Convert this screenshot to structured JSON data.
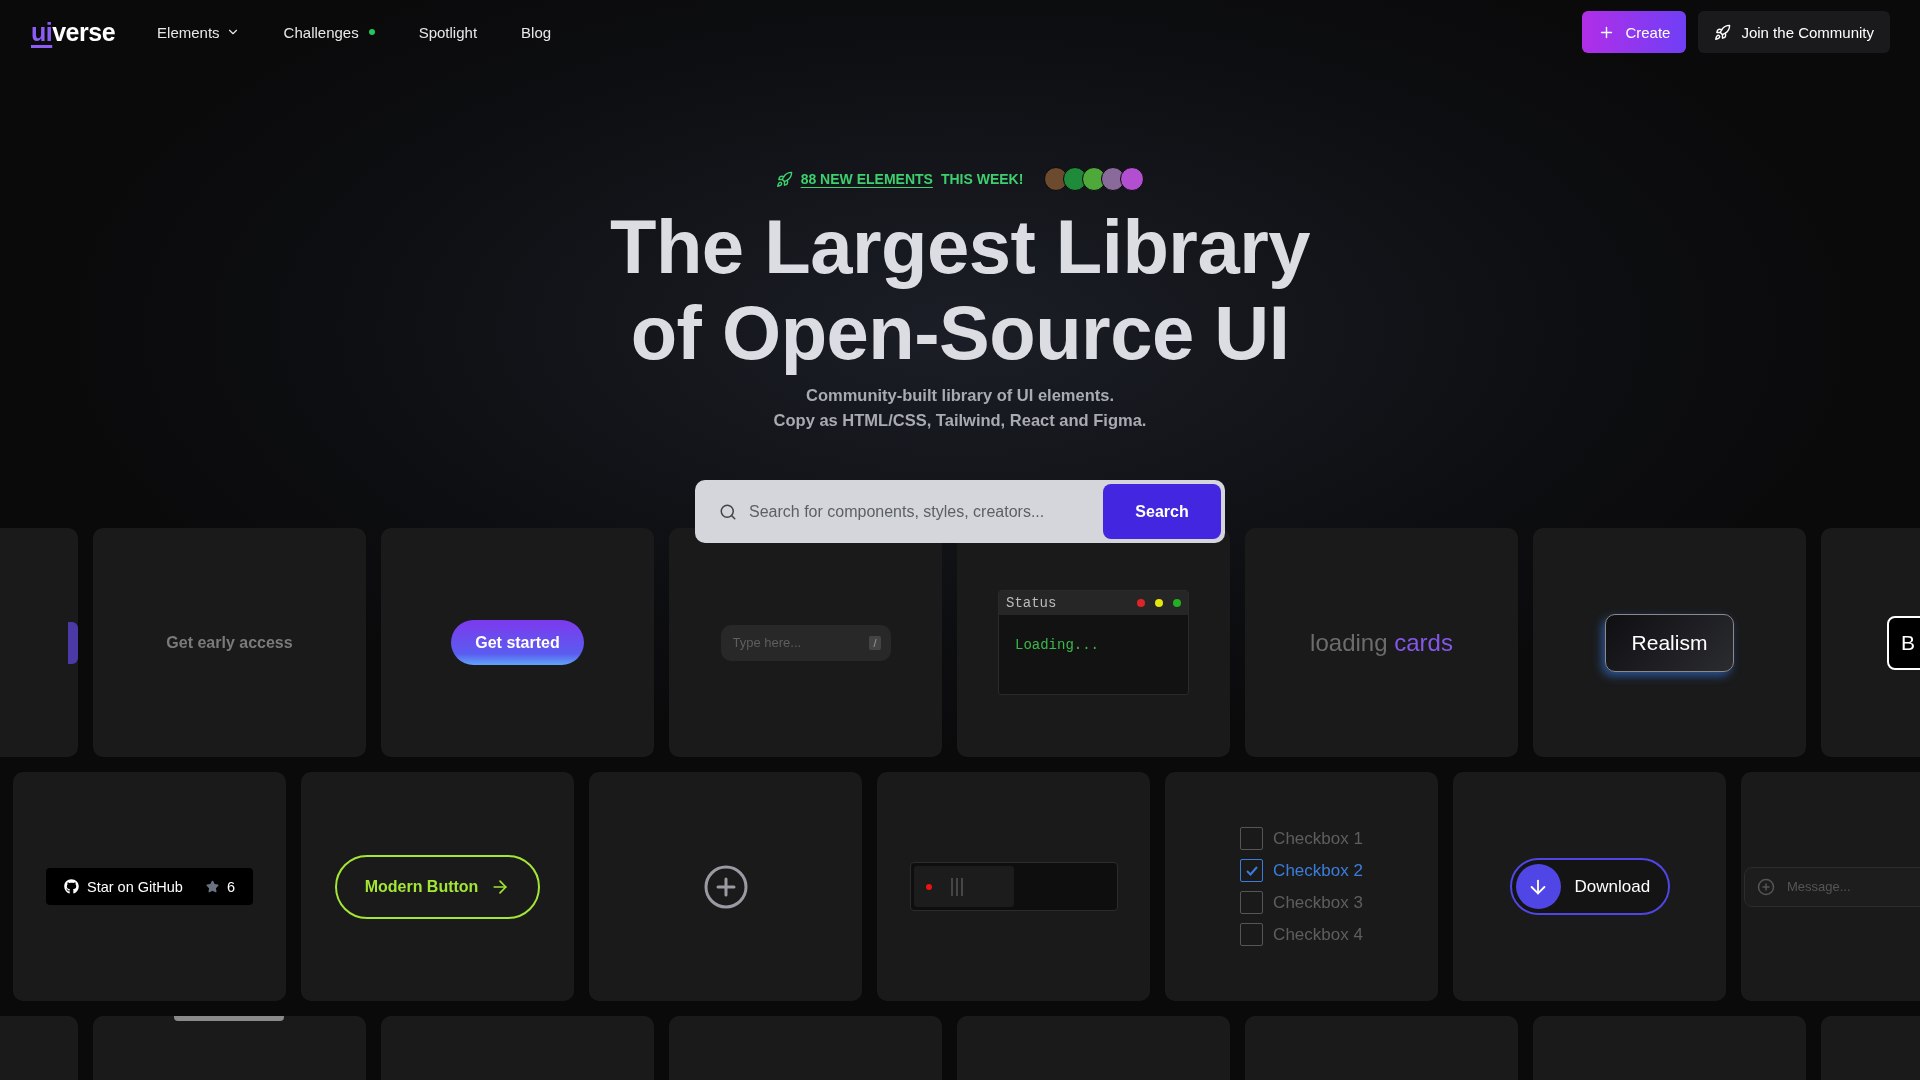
{
  "nav": {
    "logo": {
      "part_a": "ui",
      "part_b": "verse"
    },
    "links": [
      {
        "label": "Elements",
        "kind": "dropdown"
      },
      {
        "label": "Challenges",
        "kind": "dot",
        "color": "#22c55e"
      },
      {
        "label": "Spotlight",
        "kind": "plain"
      },
      {
        "label": "Blog",
        "kind": "plain"
      }
    ],
    "create_button": "Create",
    "community_button": "Join the Community"
  },
  "announcement": {
    "link": "88 NEW ELEMENTS",
    "text": "THIS WEEK!",
    "avatars": [
      {
        "color": "#6b4a2e"
      },
      {
        "color": "#1f8a3a"
      },
      {
        "color": "#4fa83a"
      },
      {
        "color": "#8a6a9a"
      },
      {
        "color": "#b14fd0"
      }
    ]
  },
  "hero": {
    "title_lines": [
      "The Largest Library",
      "of Open-Source UI"
    ],
    "subtitle_lines": [
      "Community-built library of UI elements.",
      "Copy as HTML/CSS, Tailwind, React and Figma."
    ]
  },
  "search": {
    "placeholder": "Search for components, styles, creators...",
    "button": "Search"
  },
  "rows": [
    {
      "cards": [
        {
          "kind": "edge-tab"
        },
        {
          "kind": "text",
          "text": "Get early access"
        },
        {
          "kind": "pill-button",
          "label": "Get started"
        },
        {
          "kind": "key-input",
          "placeholder": "Type here...",
          "key": "/"
        },
        {
          "kind": "terminal",
          "title": "Status",
          "text": "Loading..."
        },
        {
          "kind": "loading",
          "word": "loading",
          "highlight": "cards"
        },
        {
          "kind": "realism",
          "label": "Realism"
        },
        {
          "kind": "outline-button",
          "label": "B"
        }
      ]
    },
    {
      "cards": [
        {
          "kind": "github",
          "label": "Star on GitHub",
          "count": "6"
        },
        {
          "kind": "modern",
          "label": "Modern Button"
        },
        {
          "kind": "plus"
        },
        {
          "kind": "power-slider",
          "on": false
        },
        {
          "kind": "checkboxes",
          "items": [
            {
              "label": "Checkbox 1",
              "checked": false
            },
            {
              "label": "Checkbox 2",
              "checked": true
            },
            {
              "label": "Checkbox 3",
              "checked": false
            },
            {
              "label": "Checkbox 4",
              "checked": false
            }
          ]
        },
        {
          "kind": "download",
          "label": "Download"
        },
        {
          "kind": "message",
          "placeholder": "Message..."
        }
      ]
    },
    {
      "cards": [
        {
          "kind": "empty"
        },
        {
          "kind": "top-bar"
        },
        {
          "kind": "empty"
        },
        {
          "kind": "empty"
        },
        {
          "kind": "empty"
        },
        {
          "kind": "empty"
        },
        {
          "kind": "empty"
        },
        {
          "kind": "empty"
        }
      ]
    }
  ]
}
